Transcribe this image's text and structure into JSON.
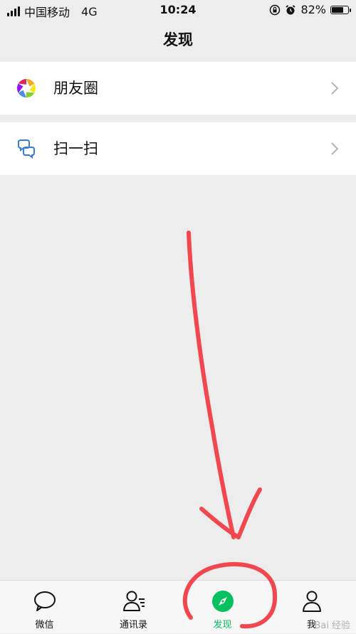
{
  "status_bar": {
    "carrier": "中国移动",
    "network": "4G",
    "time": "10:24",
    "battery_text": "82%",
    "battery_level": 0.82
  },
  "header": {
    "title": "发现"
  },
  "cells": [
    {
      "label": "朋友圈",
      "icon": "moments-icon"
    },
    {
      "label": "扫一扫",
      "icon": "scan-icon"
    }
  ],
  "tabs": [
    {
      "label": "微信",
      "icon": "chat-bubble-icon"
    },
    {
      "label": "通讯录",
      "icon": "contacts-icon"
    },
    {
      "label": "发现",
      "icon": "compass-icon",
      "active": true
    },
    {
      "label": "我",
      "icon": "person-icon"
    }
  ],
  "watermark": "Bai 经验",
  "colors": {
    "accent": "#07c160",
    "annotation": "#f2474f",
    "background": "#ededed"
  }
}
